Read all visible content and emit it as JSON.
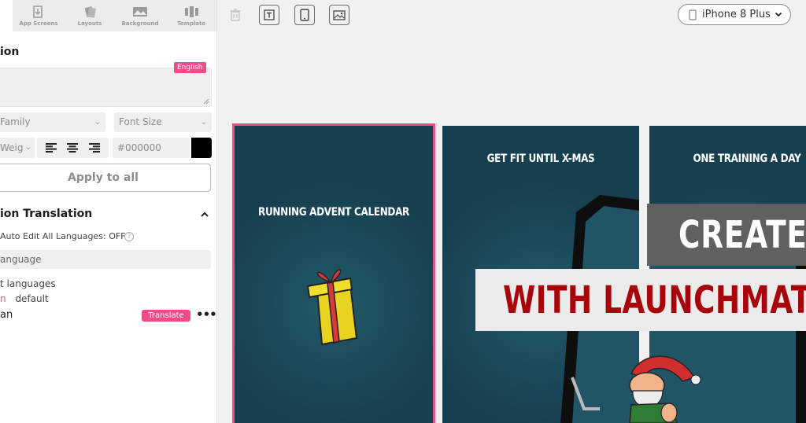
{
  "nav": {
    "items": [
      {
        "label": "App Screens",
        "icon": "app-screens-icon"
      },
      {
        "label": "Layouts",
        "icon": "layouts-icon"
      },
      {
        "label": "Background",
        "icon": "background-icon"
      },
      {
        "label": "Template",
        "icon": "template-icon"
      }
    ]
  },
  "caption": {
    "section_title": "ion",
    "language_badge": "English",
    "font_family_placeholder": "Family",
    "font_size_placeholder": "Font Size",
    "font_weight_placeholder": "Weig",
    "color_value": "#000000",
    "color_swatch": "#000000",
    "apply_label": "Apply to all"
  },
  "translation": {
    "section_title": "ion Translation",
    "auto_edit_label": "Auto Edit All Languages: OFF",
    "help_glyph": "?",
    "language_select": "anguage",
    "list_heading": "t languages",
    "default_prefix": "n",
    "default_label": "default",
    "language_name": "an",
    "translate_label": "Translate",
    "more_glyph": "•••"
  },
  "toolbar": {
    "device_label": "iPhone 8 Plus"
  },
  "screens": [
    {
      "title": "RUNNING ADVENT CALENDAR"
    },
    {
      "title": "GET FIT UNTIL X-MAS"
    },
    {
      "title": "ONE TRAINING A DAY"
    }
  ],
  "overlay": {
    "line1": "CREATE",
    "line2": "WITH LAUNCHMATIC"
  },
  "colors": {
    "accent": "#ec4d89",
    "screen_bg": "#163f4f",
    "overlay_red": "#a8050b"
  }
}
